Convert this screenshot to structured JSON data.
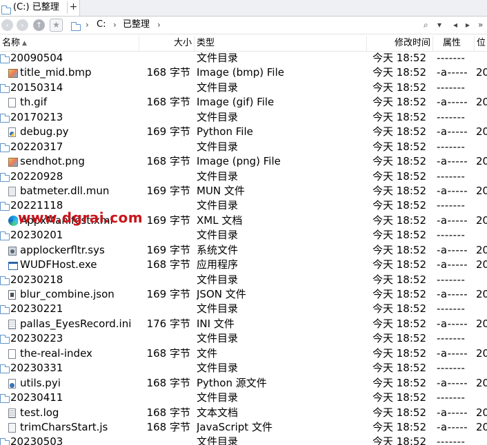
{
  "tab": {
    "title": "(C:) 已整理",
    "add_label": "+"
  },
  "breadcrumb": {
    "drive": "C:",
    "folder": "已整理"
  },
  "nav": {
    "back": "‹",
    "forward": "›",
    "up": "↑",
    "search": "⌕",
    "dropdown": "▾",
    "prev": "◂",
    "next": "▸",
    "more": "»"
  },
  "columns": {
    "name": "名称",
    "size": "大小",
    "type": "类型",
    "date": "修改时间",
    "attr": "属性",
    "pos": "位"
  },
  "files": [
    {
      "name": "20090504",
      "size": "",
      "type": "文件目录",
      "date": "今天 18:52",
      "attr": "-------",
      "pos": "",
      "icon": "folder-icon"
    },
    {
      "name": "title_mid.bmp",
      "size": "168 字节",
      "type": "Image (bmp) File",
      "date": "今天 18:52",
      "attr": "-a-----",
      "pos": "20",
      "icon": "image-file-icon"
    },
    {
      "name": "20150314",
      "size": "",
      "type": "文件目录",
      "date": "今天 18:52",
      "attr": "-------",
      "pos": "",
      "icon": "folder-icon"
    },
    {
      "name": "th.gif",
      "size": "168 字节",
      "type": "Image (gif) File",
      "date": "今天 18:52",
      "attr": "-a-----",
      "pos": "20",
      "icon": "gif-file-icon"
    },
    {
      "name": "20170213",
      "size": "",
      "type": "文件目录",
      "date": "今天 18:52",
      "attr": "-------",
      "pos": "",
      "icon": "folder-icon"
    },
    {
      "name": "debug.py",
      "size": "169 字节",
      "type": "Python File",
      "date": "今天 18:52",
      "attr": "-a-----",
      "pos": "20",
      "icon": "python-file-icon"
    },
    {
      "name": "20220317",
      "size": "",
      "type": "文件目录",
      "date": "今天 18:52",
      "attr": "-------",
      "pos": "",
      "icon": "folder-icon"
    },
    {
      "name": "sendhot.png",
      "size": "168 字节",
      "type": "Image (png) File",
      "date": "今天 18:52",
      "attr": "-a-----",
      "pos": "20",
      "icon": "image-file-icon"
    },
    {
      "name": "20220928",
      "size": "",
      "type": "文件目录",
      "date": "今天 18:52",
      "attr": "-------",
      "pos": "",
      "icon": "folder-icon"
    },
    {
      "name": "batmeter.dll.mun",
      "size": "169 字节",
      "type": "MUN 文件",
      "date": "今天 18:52",
      "attr": "-a-----",
      "pos": "20",
      "icon": "dll-file-icon"
    },
    {
      "name": "20221118",
      "size": "",
      "type": "文件目录",
      "date": "今天 18:52",
      "attr": "-------",
      "pos": "",
      "icon": "folder-icon"
    },
    {
      "name": "AppxManifest.xml",
      "size": "169 字节",
      "type": "XML 文档",
      "date": "今天 18:52",
      "attr": "-a-----",
      "pos": "20",
      "icon": "edge-icon"
    },
    {
      "name": "20230201",
      "size": "",
      "type": "文件目录",
      "date": "今天 18:52",
      "attr": "-------",
      "pos": "",
      "icon": "folder-icon"
    },
    {
      "name": "applockerfltr.sys",
      "size": "169 字节",
      "type": "系统文件",
      "date": "今天 18:52",
      "attr": "-a-----",
      "pos": "20",
      "icon": "system-file-icon"
    },
    {
      "name": "WUDFHost.exe",
      "size": "168 字节",
      "type": "应用程序",
      "date": "今天 18:52",
      "attr": "-a-----",
      "pos": "20",
      "icon": "exe-file-icon"
    },
    {
      "name": "20230218",
      "size": "",
      "type": "文件目录",
      "date": "今天 18:52",
      "attr": "-------",
      "pos": "",
      "icon": "folder-icon"
    },
    {
      "name": "blur_combine.json",
      "size": "169 字节",
      "type": "JSON 文件",
      "date": "今天 18:52",
      "attr": "-a-----",
      "pos": "20",
      "icon": "json-file-icon"
    },
    {
      "name": "20230221",
      "size": "",
      "type": "文件目录",
      "date": "今天 18:52",
      "attr": "-------",
      "pos": "",
      "icon": "folder-icon"
    },
    {
      "name": "pallas_EyesRecord.ini",
      "size": "176 字节",
      "type": "INI 文件",
      "date": "今天 18:52",
      "attr": "-a-----",
      "pos": "20",
      "icon": "ini-file-icon"
    },
    {
      "name": "20230223",
      "size": "",
      "type": "文件目录",
      "date": "今天 18:52",
      "attr": "-------",
      "pos": "",
      "icon": "folder-icon"
    },
    {
      "name": "the-real-index",
      "size": "168 字节",
      "type": "文件",
      "date": "今天 18:52",
      "attr": "-a-----",
      "pos": "20",
      "icon": "generic-file-icon"
    },
    {
      "name": "20230331",
      "size": "",
      "type": "文件目录",
      "date": "今天 18:52",
      "attr": "-------",
      "pos": "",
      "icon": "folder-icon"
    },
    {
      "name": "utils.pyi",
      "size": "168 字节",
      "type": "Python 源文件",
      "date": "今天 18:52",
      "attr": "-a-----",
      "pos": "20",
      "icon": "python-source-icon"
    },
    {
      "name": "20230411",
      "size": "",
      "type": "文件目录",
      "date": "今天 18:52",
      "attr": "-------",
      "pos": "",
      "icon": "folder-icon"
    },
    {
      "name": "test.log",
      "size": "168 字节",
      "type": "文本文档",
      "date": "今天 18:52",
      "attr": "-a-----",
      "pos": "20",
      "icon": "text-file-icon"
    },
    {
      "name": "trimCharsStart.js",
      "size": "168 字节",
      "type": "JavaScript 文件",
      "date": "今天 18:52",
      "attr": "-a-----",
      "pos": "20",
      "icon": "js-file-icon"
    },
    {
      "name": "20230503",
      "size": "",
      "type": "文件目录",
      "date": "今天 18:52",
      "attr": "-------",
      "pos": "",
      "icon": "folder-icon"
    }
  ],
  "watermark": "www.dgrai.com"
}
